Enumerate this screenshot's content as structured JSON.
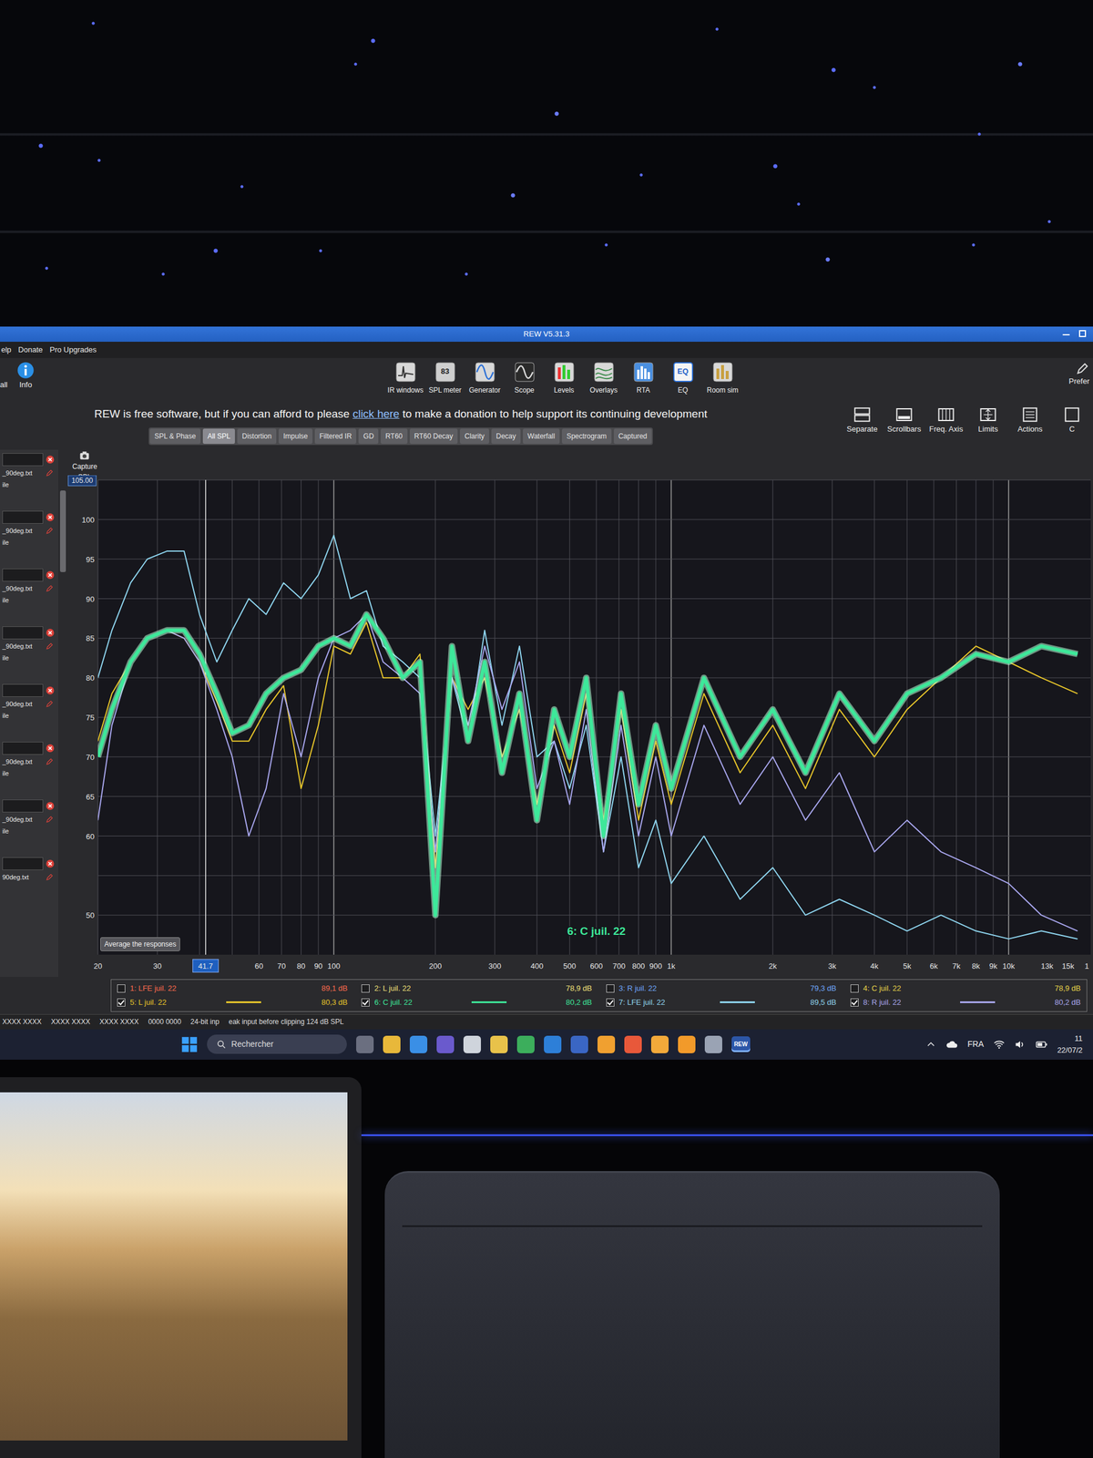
{
  "window": {
    "title": "REW V5.31.3"
  },
  "menu": [
    "elp",
    "Donate",
    "Pro Upgrades"
  ],
  "left_tools": [
    "all",
    "Info"
  ],
  "toolbar": [
    {
      "label": "IR windows"
    },
    {
      "label": "SPL meter",
      "glyph": "83"
    },
    {
      "label": "Generator"
    },
    {
      "label": "Scope"
    },
    {
      "label": "Levels"
    },
    {
      "label": "Overlays"
    },
    {
      "label": "RTA"
    },
    {
      "label": "EQ",
      "glyph": "EQ"
    },
    {
      "label": "Room sim"
    }
  ],
  "preferences": "Prefer",
  "banner": {
    "before": "REW is free software, but if you can afford to please ",
    "link": "click here",
    "after": " to make a donation to help support its continuing development"
  },
  "tabs": [
    {
      "label": "SPL & Phase",
      "selected": false
    },
    {
      "label": "All SPL",
      "selected": true
    },
    {
      "label": "Distortion",
      "selected": false
    },
    {
      "label": "Impulse",
      "selected": false
    },
    {
      "label": "Filtered IR",
      "selected": false
    },
    {
      "label": "GD",
      "selected": false
    },
    {
      "label": "RT60",
      "selected": false
    },
    {
      "label": "RT60 Decay",
      "selected": false
    },
    {
      "label": "Clarity",
      "selected": false
    },
    {
      "label": "Decay",
      "selected": false
    },
    {
      "label": "Waterfall",
      "selected": false
    },
    {
      "label": "Spectrogram",
      "selected": false
    },
    {
      "label": "Captured",
      "selected": false
    }
  ],
  "right_tools": [
    "Separate",
    "Scrollbars",
    "Freq. Axis",
    "Limits",
    "Actions",
    "C"
  ],
  "capture": {
    "label": "Capture",
    "unit": "SPL"
  },
  "files": [
    {
      "name": "_90deg.txt",
      "note": "ile"
    },
    {
      "name": "_90deg.txt",
      "note": "ile"
    },
    {
      "name": "_90deg.txt",
      "note": "ile"
    },
    {
      "name": "_90deg.txt",
      "note": "ile"
    },
    {
      "name": "_90deg.txt",
      "note": "ile"
    },
    {
      "name": "_90deg.txt",
      "note": "ile"
    },
    {
      "name": "_90deg.txt",
      "note": "ile"
    },
    {
      "name": "90deg.txt"
    }
  ],
  "chart": {
    "top_field": "105.00",
    "y_ticks": [
      {
        "value": 100,
        "label": "100"
      },
      {
        "value": 95,
        "label": "95"
      },
      {
        "value": 90,
        "label": "90"
      },
      {
        "value": 85,
        "label": "85"
      },
      {
        "value": 80,
        "label": "80"
      },
      {
        "value": 75,
        "label": "75"
      },
      {
        "value": 70,
        "label": "70"
      },
      {
        "value": 65,
        "label": "65"
      },
      {
        "value": 60,
        "label": "60"
      },
      {
        "value": 50,
        "label": "50"
      }
    ],
    "x_ticks": [
      {
        "value": 20,
        "label": "20"
      },
      {
        "value": 30,
        "label": "30"
      },
      {
        "value": 60,
        "label": "60"
      },
      {
        "value": 70,
        "label": "70"
      },
      {
        "value": 80,
        "label": "80"
      },
      {
        "value": 90,
        "label": "90"
      },
      {
        "value": 100,
        "label": "100"
      },
      {
        "value": 200,
        "label": "200"
      },
      {
        "value": 300,
        "label": "300"
      },
      {
        "value": 400,
        "label": "400"
      },
      {
        "value": 500,
        "label": "500"
      },
      {
        "value": 600,
        "label": "600"
      },
      {
        "value": 700,
        "label": "700"
      },
      {
        "value": 800,
        "label": "800"
      },
      {
        "value": 900,
        "label": "900"
      },
      {
        "value": 1000,
        "label": "1k"
      },
      {
        "value": 2000,
        "label": "2k"
      },
      {
        "value": 3000,
        "label": "3k"
      },
      {
        "value": 4000,
        "label": "4k"
      },
      {
        "value": 5000,
        "label": "5k"
      },
      {
        "value": 6000,
        "label": "6k"
      },
      {
        "value": 7000,
        "label": "7k"
      },
      {
        "value": 8000,
        "label": "8k"
      },
      {
        "value": 9000,
        "label": "9k"
      },
      {
        "value": 10000,
        "label": "10k"
      },
      {
        "value": 13000,
        "label": "13k"
      },
      {
        "value": 15000,
        "label": "15k"
      },
      {
        "value": 17000,
        "label": "1"
      }
    ],
    "cursor": {
      "value": 41.7,
      "label": "41.7"
    },
    "hover_label": "6: C juil. 22",
    "average_button": "Average the responses",
    "freqs": [
      20,
      22,
      25,
      28,
      32,
      36,
      40,
      45,
      50,
      56,
      63,
      71,
      80,
      90,
      100,
      112,
      125,
      140,
      160,
      180,
      200,
      224,
      250,
      280,
      315,
      355,
      400,
      450,
      500,
      560,
      630,
      710,
      800,
      900,
      1000,
      1250,
      1600,
      2000,
      2500,
      3150,
      4000,
      5000,
      6300,
      8000,
      10000,
      12500,
      16000
    ]
  },
  "legend": [
    {
      "label": "1: LFE juil. 22",
      "reading": "89,1 dB",
      "checked": false,
      "color": "#ff6a4d"
    },
    {
      "label": "5: L juil. 22",
      "reading": "80,3 dB",
      "checked": true,
      "color": "#e8c62a",
      "highlight": false,
      "values": [
        72,
        78,
        82,
        85,
        86,
        85,
        82,
        77,
        72,
        72,
        76,
        79,
        66,
        74,
        84,
        83,
        87,
        80,
        80,
        83,
        56,
        80,
        76,
        80,
        70,
        76,
        64,
        74,
        68,
        78,
        62,
        76,
        62,
        72,
        64,
        78,
        68,
        74,
        66,
        76,
        70,
        76,
        80,
        84,
        82,
        80,
        78
      ]
    },
    {
      "label": "2: L juil. 22",
      "reading": "78,9 dB",
      "checked": false,
      "color": "#f2e27a"
    },
    {
      "label": "6: C juil. 22",
      "reading": "80,2 dB",
      "checked": true,
      "color": "#3ee89a",
      "highlight": true,
      "values": [
        70,
        76,
        82,
        85,
        86,
        86,
        83,
        78,
        73,
        74,
        78,
        80,
        81,
        84,
        85,
        84,
        88,
        85,
        80,
        82,
        50,
        84,
        72,
        82,
        68,
        78,
        62,
        76,
        70,
        80,
        60,
        78,
        64,
        74,
        66,
        80,
        70,
        76,
        68,
        78,
        72,
        78,
        80,
        83,
        82,
        84,
        83
      ]
    },
    {
      "label": "3: R juil. 22",
      "reading": "79,3 dB",
      "checked": false,
      "color": "#6fa8ff"
    },
    {
      "label": "7: LFE juil. 22",
      "reading": "89,5 dB",
      "checked": true,
      "color": "#8fd6f0",
      "highlight": false,
      "values": [
        80,
        86,
        92,
        95,
        96,
        96,
        88,
        82,
        86,
        90,
        88,
        92,
        90,
        93,
        98,
        90,
        91,
        84,
        82,
        80,
        60,
        80,
        72,
        86,
        74,
        84,
        70,
        72,
        66,
        74,
        58,
        70,
        56,
        62,
        54,
        60,
        52,
        56,
        50,
        52,
        50,
        48,
        50,
        48,
        47,
        48,
        47
      ]
    },
    {
      "label": "4: C juil. 22",
      "reading": "78,9 dB",
      "checked": false,
      "color": "#e8d44a"
    },
    {
      "label": "8: R juil. 22",
      "reading": "80,2 dB",
      "checked": true,
      "color": "#a9a7ef",
      "highlight": false,
      "values": [
        62,
        74,
        82,
        85,
        86,
        85,
        82,
        76,
        70,
        60,
        66,
        78,
        70,
        80,
        85,
        86,
        88,
        82,
        80,
        78,
        58,
        80,
        74,
        84,
        76,
        82,
        66,
        72,
        64,
        76,
        58,
        74,
        60,
        70,
        60,
        74,
        64,
        70,
        62,
        68,
        58,
        62,
        58,
        56,
        54,
        50,
        48
      ]
    }
  ],
  "status_bar": [
    "XXXX XXXX",
    "XXXX XXXX",
    "XXXX XXXX",
    "0000 0000",
    "24-bit inp",
    "eak input before clipping 124 dB SPL"
  ],
  "taskbar": {
    "search": "Rechercher",
    "app": {
      "label": "REW",
      "active": true
    },
    "lang": "FRA",
    "time": "11",
    "date": "22/07/2"
  }
}
